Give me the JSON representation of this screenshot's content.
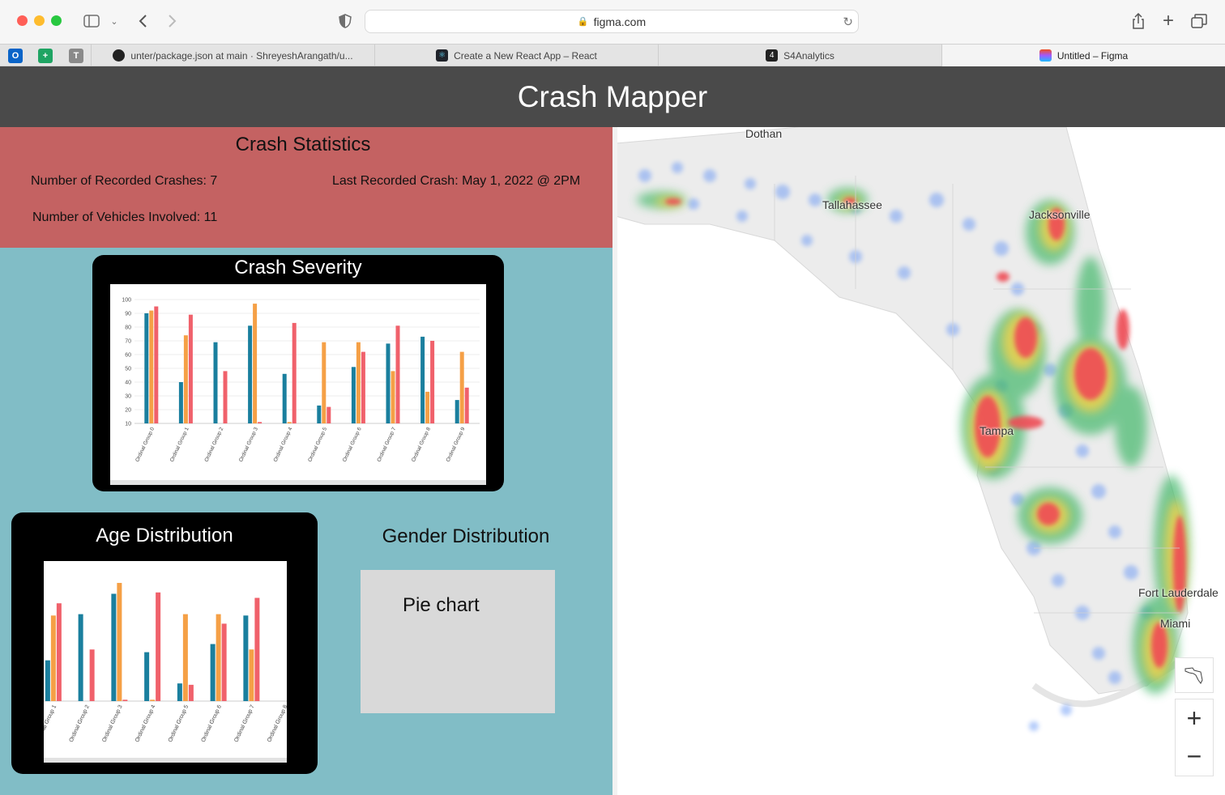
{
  "browser": {
    "url": "figma.com",
    "tabs": [
      {
        "label": "unter/package.json at main · ShreyeshArangath/u..."
      },
      {
        "label": "Create a New React App – React"
      },
      {
        "label": "S4Analytics"
      },
      {
        "label": "Untitled – Figma"
      }
    ]
  },
  "app": {
    "title": "Crash Mapper"
  },
  "stats": {
    "heading": "Crash Statistics",
    "crashes": "Number of Recorded Crashes: 7",
    "last_crash": "Last Recorded Crash: May 1, 2022 @ 2PM",
    "vehicles": "Number of Vehicles Involved: 11"
  },
  "severity": {
    "title": "Crash Severity",
    "chart_data": {
      "type": "bar",
      "categories": [
        "Ordinal Group 0",
        "Ordinal Group 1",
        "Ordinal Group 2",
        "Ordinal Group 3",
        "Ordinal Group 4",
        "Ordinal Group 5",
        "Ordinal Group 6",
        "Ordinal Group 7",
        "Ordinal Group 8",
        "Ordinal Group 9"
      ],
      "series": [
        {
          "values": [
            90,
            40,
            69,
            81,
            46,
            23,
            51,
            68,
            73,
            27
          ],
          "color": "#1a7f9e"
        },
        {
          "values": [
            92,
            74,
            0,
            97,
            11,
            69,
            69,
            48,
            33,
            62
          ],
          "color": "#f5a046"
        },
        {
          "values": [
            95,
            89,
            48,
            11,
            83,
            22,
            62,
            81,
            70,
            36
          ],
          "color": "#f0616b"
        }
      ],
      "yticks": [
        10,
        20,
        30,
        40,
        50,
        60,
        70,
        80,
        90,
        100
      ],
      "ylim": [
        10,
        100
      ]
    }
  },
  "age": {
    "title": "Age Distribution",
    "chart_data": {
      "type": "bar",
      "categories": [
        "Ordinal Group 1",
        "Ordinal Group 2",
        "Ordinal Group 3",
        "Ordinal Group 4",
        "Ordinal Group 5",
        "Ordinal Group 6",
        "Ordinal Group 7",
        "Ordinal Group 8"
      ],
      "series": [
        {
          "values": [
            40,
            74,
            89,
            46,
            23,
            52,
            73,
            0
          ],
          "color": "#1a7f9e"
        },
        {
          "values": [
            73,
            0,
            97,
            11,
            74,
            74,
            48,
            0
          ],
          "color": "#f5a046"
        },
        {
          "values": [
            82,
            48,
            11,
            90,
            22,
            67,
            86,
            0
          ],
          "color": "#f0616b"
        }
      ],
      "ylim": [
        10,
        100
      ]
    }
  },
  "gender": {
    "title": "Gender Distribution",
    "placeholder": "Pie chart"
  },
  "map": {
    "labels": [
      "Dothan",
      "Tallahassee",
      "Jacksonville",
      "Tampa",
      "Fort Lauderdale",
      "Miami"
    ],
    "zoom_in": "+",
    "zoom_out": "−"
  }
}
